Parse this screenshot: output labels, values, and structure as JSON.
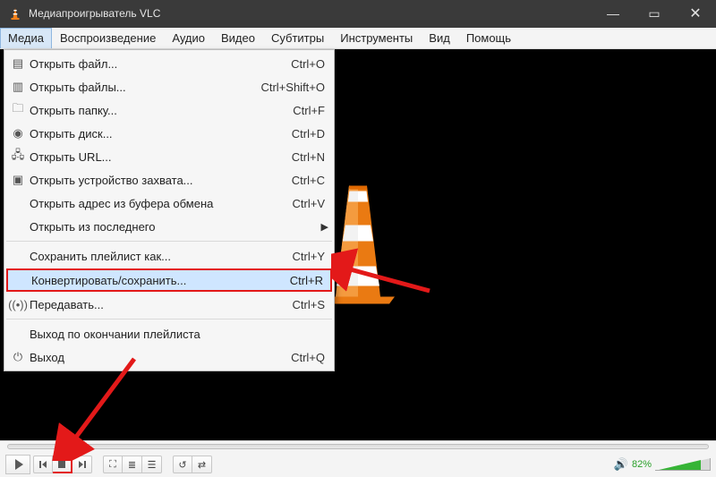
{
  "titlebar": {
    "title": "Медиапроигрыватель VLC"
  },
  "menubar": {
    "items": [
      "Медиа",
      "Воспроизведение",
      "Аудио",
      "Видео",
      "Субтитры",
      "Инструменты",
      "Вид",
      "Помощь"
    ],
    "open_index": 0
  },
  "dropdown": {
    "rows": [
      {
        "icon": "file-icon",
        "label": "Открыть файл...",
        "shortcut": "Ctrl+O"
      },
      {
        "icon": "files-icon",
        "label": "Открыть файлы...",
        "shortcut": "Ctrl+Shift+O"
      },
      {
        "icon": "folder-icon",
        "label": "Открыть папку...",
        "shortcut": "Ctrl+F"
      },
      {
        "icon": "disc-icon",
        "label": "Открыть диск...",
        "shortcut": "Ctrl+D"
      },
      {
        "icon": "network-icon",
        "label": "Открыть URL...",
        "shortcut": "Ctrl+N"
      },
      {
        "icon": "capture-icon",
        "label": "Открыть устройство захвата...",
        "shortcut": "Ctrl+C"
      },
      {
        "icon": "",
        "label": "Открыть адрес из буфера обмена",
        "shortcut": "Ctrl+V"
      },
      {
        "icon": "",
        "label": "Открыть из последнего",
        "shortcut": "",
        "submenu": true
      },
      {
        "sep": true
      },
      {
        "icon": "",
        "label": "Сохранить плейлист как...",
        "shortcut": "Ctrl+Y"
      },
      {
        "icon": "",
        "label": "Конвертировать/сохранить...",
        "shortcut": "Ctrl+R",
        "highlight": true
      },
      {
        "icon": "stream-icon",
        "label": "Передавать...",
        "shortcut": "Ctrl+S"
      },
      {
        "sep": true
      },
      {
        "icon": "",
        "label": "Выход по окончании плейлиста",
        "shortcut": ""
      },
      {
        "icon": "quit-icon",
        "label": "Выход",
        "shortcut": "Ctrl+Q"
      }
    ]
  },
  "controls": {
    "volume_pct": "82%"
  }
}
